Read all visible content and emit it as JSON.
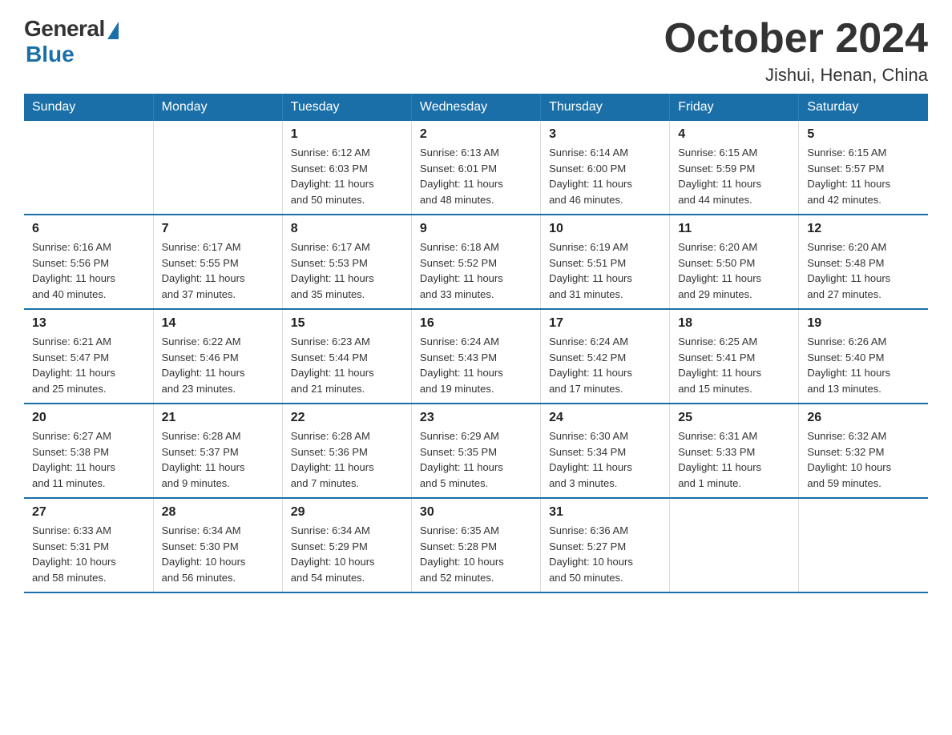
{
  "logo": {
    "general": "General",
    "blue": "Blue"
  },
  "title": "October 2024",
  "subtitle": "Jishui, Henan, China",
  "days_of_week": [
    "Sunday",
    "Monday",
    "Tuesday",
    "Wednesday",
    "Thursday",
    "Friday",
    "Saturday"
  ],
  "weeks": [
    [
      {
        "day": "",
        "info": ""
      },
      {
        "day": "",
        "info": ""
      },
      {
        "day": "1",
        "info": "Sunrise: 6:12 AM\nSunset: 6:03 PM\nDaylight: 11 hours\nand 50 minutes."
      },
      {
        "day": "2",
        "info": "Sunrise: 6:13 AM\nSunset: 6:01 PM\nDaylight: 11 hours\nand 48 minutes."
      },
      {
        "day": "3",
        "info": "Sunrise: 6:14 AM\nSunset: 6:00 PM\nDaylight: 11 hours\nand 46 minutes."
      },
      {
        "day": "4",
        "info": "Sunrise: 6:15 AM\nSunset: 5:59 PM\nDaylight: 11 hours\nand 44 minutes."
      },
      {
        "day": "5",
        "info": "Sunrise: 6:15 AM\nSunset: 5:57 PM\nDaylight: 11 hours\nand 42 minutes."
      }
    ],
    [
      {
        "day": "6",
        "info": "Sunrise: 6:16 AM\nSunset: 5:56 PM\nDaylight: 11 hours\nand 40 minutes."
      },
      {
        "day": "7",
        "info": "Sunrise: 6:17 AM\nSunset: 5:55 PM\nDaylight: 11 hours\nand 37 minutes."
      },
      {
        "day": "8",
        "info": "Sunrise: 6:17 AM\nSunset: 5:53 PM\nDaylight: 11 hours\nand 35 minutes."
      },
      {
        "day": "9",
        "info": "Sunrise: 6:18 AM\nSunset: 5:52 PM\nDaylight: 11 hours\nand 33 minutes."
      },
      {
        "day": "10",
        "info": "Sunrise: 6:19 AM\nSunset: 5:51 PM\nDaylight: 11 hours\nand 31 minutes."
      },
      {
        "day": "11",
        "info": "Sunrise: 6:20 AM\nSunset: 5:50 PM\nDaylight: 11 hours\nand 29 minutes."
      },
      {
        "day": "12",
        "info": "Sunrise: 6:20 AM\nSunset: 5:48 PM\nDaylight: 11 hours\nand 27 minutes."
      }
    ],
    [
      {
        "day": "13",
        "info": "Sunrise: 6:21 AM\nSunset: 5:47 PM\nDaylight: 11 hours\nand 25 minutes."
      },
      {
        "day": "14",
        "info": "Sunrise: 6:22 AM\nSunset: 5:46 PM\nDaylight: 11 hours\nand 23 minutes."
      },
      {
        "day": "15",
        "info": "Sunrise: 6:23 AM\nSunset: 5:44 PM\nDaylight: 11 hours\nand 21 minutes."
      },
      {
        "day": "16",
        "info": "Sunrise: 6:24 AM\nSunset: 5:43 PM\nDaylight: 11 hours\nand 19 minutes."
      },
      {
        "day": "17",
        "info": "Sunrise: 6:24 AM\nSunset: 5:42 PM\nDaylight: 11 hours\nand 17 minutes."
      },
      {
        "day": "18",
        "info": "Sunrise: 6:25 AM\nSunset: 5:41 PM\nDaylight: 11 hours\nand 15 minutes."
      },
      {
        "day": "19",
        "info": "Sunrise: 6:26 AM\nSunset: 5:40 PM\nDaylight: 11 hours\nand 13 minutes."
      }
    ],
    [
      {
        "day": "20",
        "info": "Sunrise: 6:27 AM\nSunset: 5:38 PM\nDaylight: 11 hours\nand 11 minutes."
      },
      {
        "day": "21",
        "info": "Sunrise: 6:28 AM\nSunset: 5:37 PM\nDaylight: 11 hours\nand 9 minutes."
      },
      {
        "day": "22",
        "info": "Sunrise: 6:28 AM\nSunset: 5:36 PM\nDaylight: 11 hours\nand 7 minutes."
      },
      {
        "day": "23",
        "info": "Sunrise: 6:29 AM\nSunset: 5:35 PM\nDaylight: 11 hours\nand 5 minutes."
      },
      {
        "day": "24",
        "info": "Sunrise: 6:30 AM\nSunset: 5:34 PM\nDaylight: 11 hours\nand 3 minutes."
      },
      {
        "day": "25",
        "info": "Sunrise: 6:31 AM\nSunset: 5:33 PM\nDaylight: 11 hours\nand 1 minute."
      },
      {
        "day": "26",
        "info": "Sunrise: 6:32 AM\nSunset: 5:32 PM\nDaylight: 10 hours\nand 59 minutes."
      }
    ],
    [
      {
        "day": "27",
        "info": "Sunrise: 6:33 AM\nSunset: 5:31 PM\nDaylight: 10 hours\nand 58 minutes."
      },
      {
        "day": "28",
        "info": "Sunrise: 6:34 AM\nSunset: 5:30 PM\nDaylight: 10 hours\nand 56 minutes."
      },
      {
        "day": "29",
        "info": "Sunrise: 6:34 AM\nSunset: 5:29 PM\nDaylight: 10 hours\nand 54 minutes."
      },
      {
        "day": "30",
        "info": "Sunrise: 6:35 AM\nSunset: 5:28 PM\nDaylight: 10 hours\nand 52 minutes."
      },
      {
        "day": "31",
        "info": "Sunrise: 6:36 AM\nSunset: 5:27 PM\nDaylight: 10 hours\nand 50 minutes."
      },
      {
        "day": "",
        "info": ""
      },
      {
        "day": "",
        "info": ""
      }
    ]
  ]
}
